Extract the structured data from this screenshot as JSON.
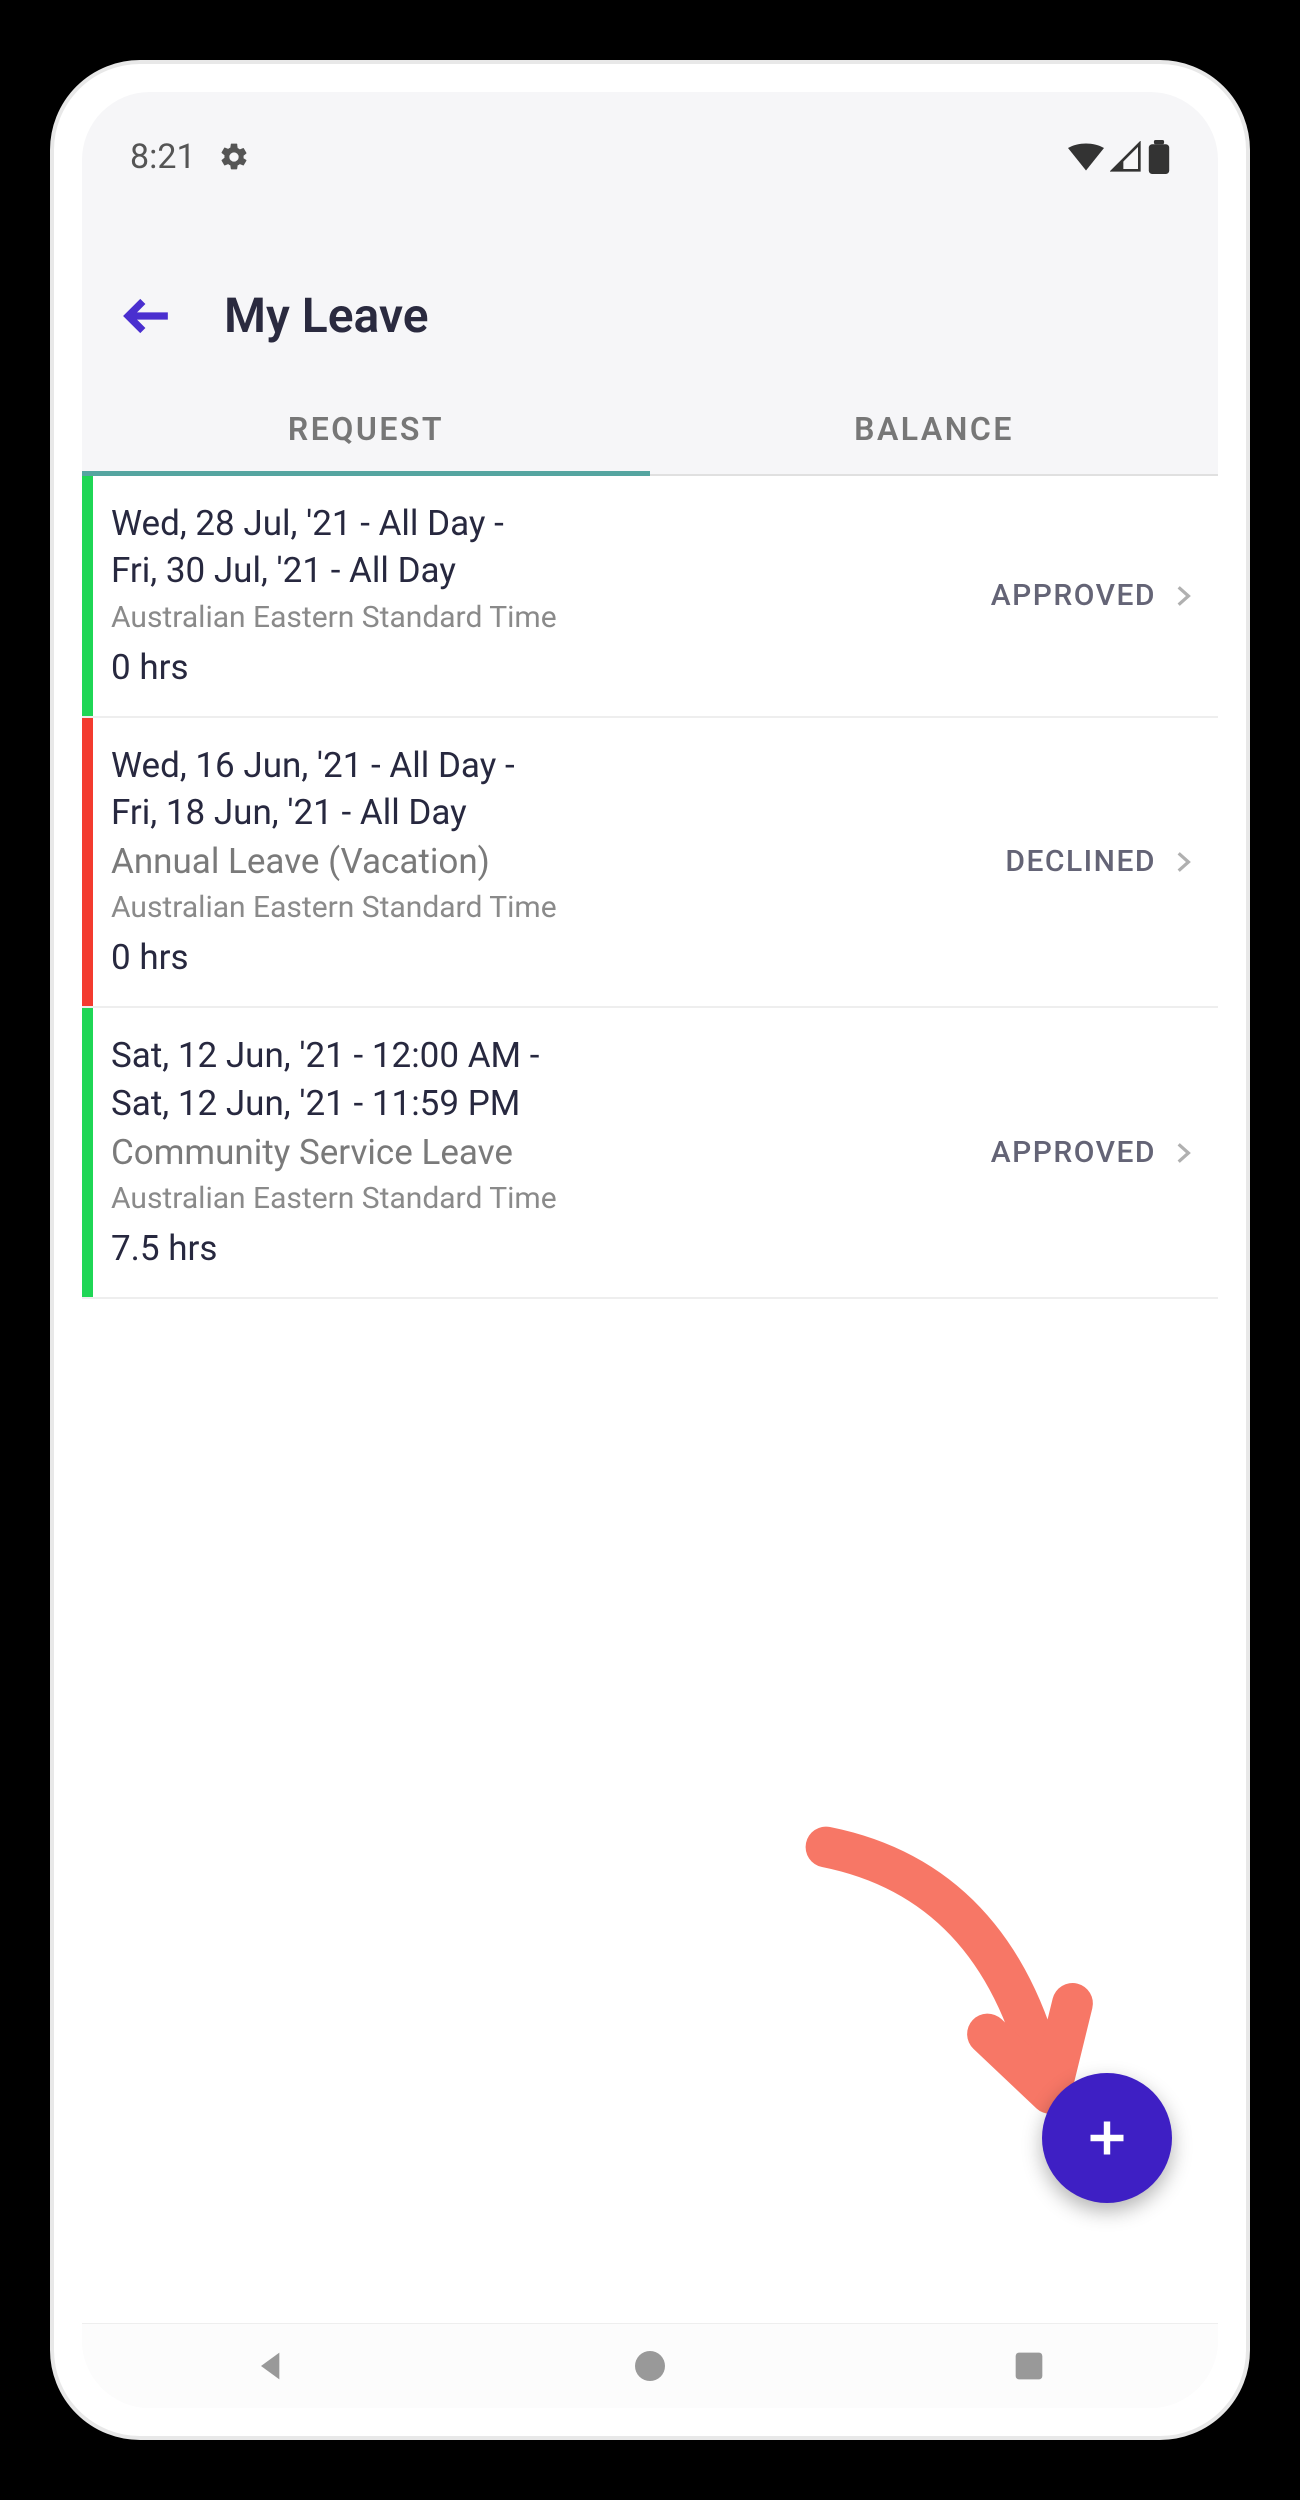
{
  "status": {
    "time": "8:21"
  },
  "header": {
    "title": "My Leave"
  },
  "tabs": {
    "request": "REQUEST",
    "balance": "BALANCE"
  },
  "colors": {
    "approved": "#1fd655",
    "declined": "#f33b2f",
    "accent": "#3e1fc4",
    "tab_indicator": "#55a5a0"
  },
  "requests": [
    {
      "date_line1": "Wed, 28 Jul, '21 - All Day -",
      "date_line2": "Fri, 30 Jul, '21 - All Day",
      "leave_type": "",
      "timezone": "Australian Eastern Standard Time",
      "hours": "0 hrs",
      "status": "APPROVED",
      "status_color": "approved"
    },
    {
      "date_line1": "Wed, 16 Jun, '21 - All Day -",
      "date_line2": "Fri, 18 Jun, '21 - All Day",
      "leave_type": "Annual Leave (Vacation)",
      "timezone": "Australian Eastern Standard Time",
      "hours": "0 hrs",
      "status": "DECLINED",
      "status_color": "declined"
    },
    {
      "date_line1": "Sat, 12 Jun, '21 - 12:00 AM -",
      "date_line2": "Sat, 12 Jun, '21 - 11:59 PM",
      "leave_type": "Community Service Leave",
      "timezone": "Australian Eastern Standard Time",
      "hours": "7.5 hrs",
      "status": "APPROVED",
      "status_color": "approved"
    }
  ]
}
